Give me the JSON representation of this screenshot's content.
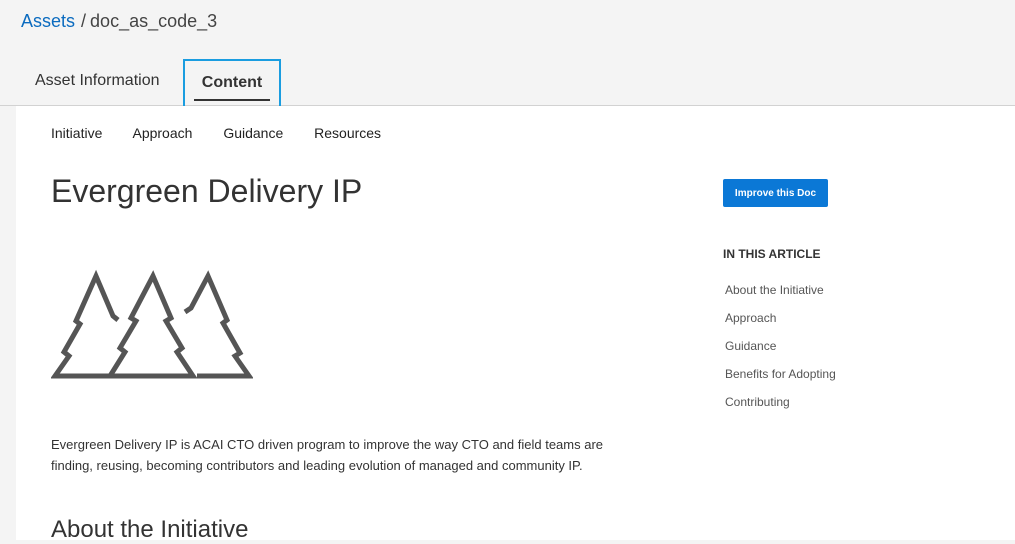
{
  "breadcrumb": {
    "root": "Assets",
    "separator": "/",
    "current": "doc_as_code_3"
  },
  "tabs": [
    {
      "label": "Asset Information",
      "active": false
    },
    {
      "label": "Content",
      "active": true
    }
  ],
  "subnav": [
    "Initiative",
    "Approach",
    "Guidance",
    "Resources"
  ],
  "article": {
    "title": "Evergreen Delivery IP",
    "hero_icon": "three-pine-trees-icon",
    "intro_line1": "Evergreen Delivery IP is ACAI CTO driven program to improve the way CTO and field teams are",
    "intro_line2": "finding, reusing, becoming contributors and leading evolution of managed and community IP.",
    "section_title": "About the Initiative"
  },
  "sidebar": {
    "improve_button": "Improve this Doc",
    "toc_heading": "IN THIS ARTICLE",
    "toc_items": [
      "About the Initiative",
      "Approach",
      "Guidance",
      "Benefits for Adopting",
      "Contributing"
    ]
  },
  "colors": {
    "link": "#0b6bbf",
    "accent_button": "#0b78d6",
    "focus_outline": "#1a9de0",
    "icon_stroke": "#555555"
  }
}
